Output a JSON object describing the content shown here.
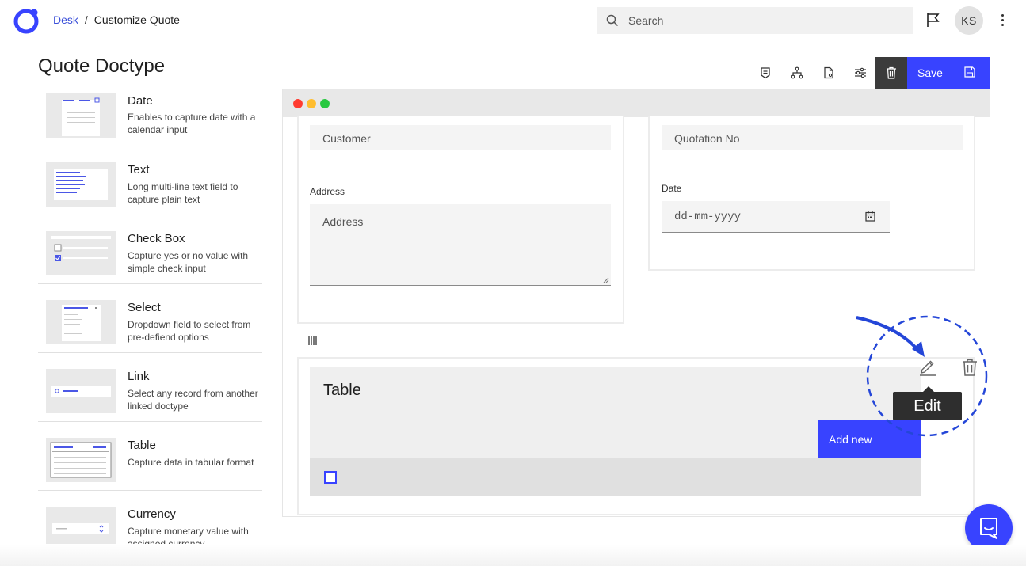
{
  "header": {
    "breadcrumb_root": "Desk",
    "breadcrumb_sep": "/",
    "breadcrumb_current": "Customize Quote",
    "search_placeholder": "Search",
    "avatar_initials": "KS"
  },
  "page_title": "Quote Doctype",
  "palette": {
    "items": [
      {
        "name": "Date",
        "desc": "Enables to capture date with a calendar input"
      },
      {
        "name": "Text",
        "desc": "Long multi-line text field to capture plain text"
      },
      {
        "name": "Check Box",
        "desc": "Capture yes or no value with simple check input"
      },
      {
        "name": "Select",
        "desc": "Dropdown field to select from pre-defiend options"
      },
      {
        "name": "Link",
        "desc": "Select any record from another linked doctype"
      },
      {
        "name": "Table",
        "desc": "Capture data in tabular format"
      },
      {
        "name": "Currency",
        "desc": "Capture monetary value with assigned currency"
      }
    ]
  },
  "toolbar": {
    "save_label": "Save"
  },
  "form": {
    "customer_placeholder": "Customer",
    "quotation_placeholder": "Quotation No",
    "address_label": "Address",
    "address_placeholder": "Address",
    "date_label": "Date",
    "date_placeholder": "dd-mm-yyyy"
  },
  "table": {
    "title": "Table",
    "add_new_label": "Add new",
    "tooltip": "Edit"
  },
  "colors": {
    "accent": "#3843ff",
    "link": "#3a4fd9",
    "annotation": "#2446d8",
    "dark_button": "#3b3b3b"
  }
}
